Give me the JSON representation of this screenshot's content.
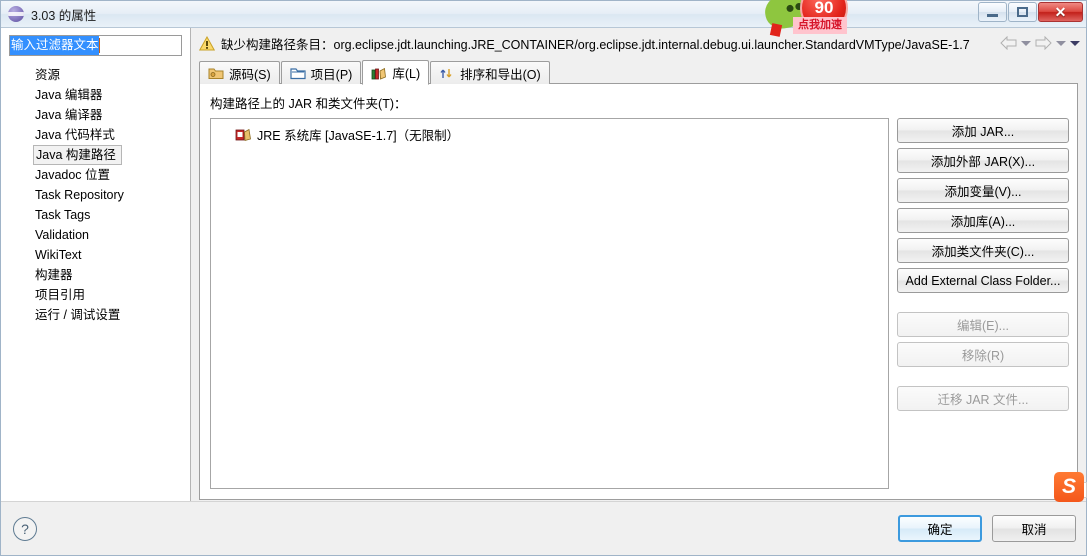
{
  "window": {
    "title": "3.03 的属性",
    "app_icon": "eclipse-sphere-icon",
    "controls": {
      "minimize": "minimize-icon",
      "maximize": "maximize-icon",
      "close": "✕"
    }
  },
  "sidebar": {
    "filter": {
      "value": "输入过滤器文本",
      "placeholder": "输入过滤器文本"
    },
    "items": [
      {
        "label": "资源",
        "selected": false
      },
      {
        "label": "Java 编辑器",
        "selected": false
      },
      {
        "label": "Java 编译器",
        "selected": false
      },
      {
        "label": "Java 代码样式",
        "selected": false
      },
      {
        "label": "Java 构建路径",
        "selected": true
      },
      {
        "label": "Javadoc 位置",
        "selected": false
      },
      {
        "label": "Task Repository",
        "selected": false
      },
      {
        "label": "Task Tags",
        "selected": false
      },
      {
        "label": "Validation",
        "selected": false
      },
      {
        "label": "WikiText",
        "selected": false
      },
      {
        "label": "构建器",
        "selected": false
      },
      {
        "label": "项目引用",
        "selected": false
      },
      {
        "label": "运行 / 调试设置",
        "selected": false
      }
    ]
  },
  "message_bar": {
    "icon": "warning-icon",
    "text": "缺少构建路径条目：org.eclipse.jdt.launching.JRE_CONTAINER/org.eclipse.jdt.internal.debug.ui.launcher.StandardVMType/JavaSE-1.7",
    "nav": {
      "back": "back-arrow-icon",
      "back_menu": "chevron-down-icon",
      "forward": "forward-arrow-icon",
      "forward_menu": "chevron-down-icon",
      "more": "chevron-down-icon"
    }
  },
  "tabs": [
    {
      "label": "源码(S)",
      "icon": "source-folder-icon",
      "active": false
    },
    {
      "label": "项目(P)",
      "icon": "project-folder-icon",
      "active": false
    },
    {
      "label": "库(L)",
      "icon": "library-books-icon",
      "active": true
    },
    {
      "label": "排序和导出(O)",
      "icon": "order-export-icon",
      "active": false
    }
  ],
  "panel": {
    "label": "构建路径上的 JAR 和类文件夹(T)：",
    "entries": [
      {
        "icon": "jre-library-icon",
        "label": "JRE 系统库 [JavaSE-1.7]（无限制）"
      }
    ]
  },
  "buttons": {
    "primary_group": [
      {
        "label": "添加 JAR...",
        "enabled": true,
        "name": "add-jar-button"
      },
      {
        "label": "添加外部 JAR(X)...",
        "enabled": true,
        "name": "add-external-jar-button"
      },
      {
        "label": "添加变量(V)...",
        "enabled": true,
        "name": "add-variable-button"
      },
      {
        "label": "添加库(A)...",
        "enabled": true,
        "name": "add-library-button"
      },
      {
        "label": "添加类文件夹(C)...",
        "enabled": true,
        "name": "add-class-folder-button"
      },
      {
        "label": "Add External Class Folder...",
        "enabled": true,
        "name": "add-external-class-folder-button"
      }
    ],
    "secondary_group": [
      {
        "label": "编辑(E)...",
        "enabled": false,
        "name": "edit-button"
      },
      {
        "label": "移除(R)",
        "enabled": false,
        "name": "remove-button"
      }
    ],
    "tertiary_group": [
      {
        "label": "迁移 JAR 文件...",
        "enabled": false,
        "name": "migrate-jar-button"
      }
    ]
  },
  "footer": {
    "help_icon": "?",
    "ok_label": "确定",
    "cancel_label": "取消"
  },
  "overlays": {
    "mascot": {
      "counter": "90",
      "badge_text": "点我加速"
    },
    "sogou": {
      "letter": "S"
    }
  }
}
